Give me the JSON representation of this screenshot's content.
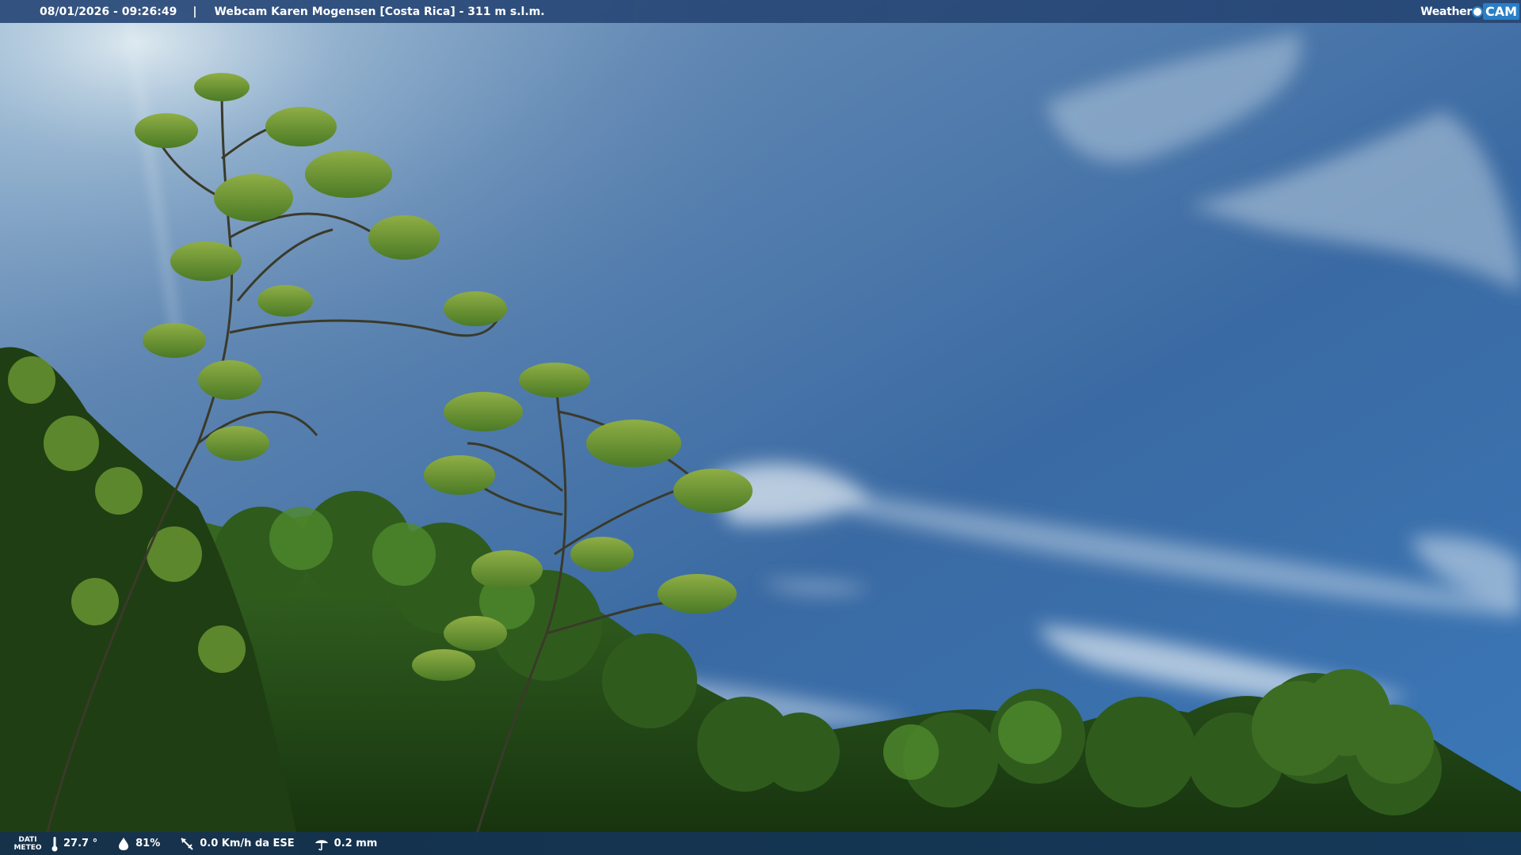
{
  "header": {
    "datetime": "08/01/2026 - 09:26:49",
    "separator": "|",
    "title": "Webcam Karen Mogensen [Costa Rica] - 311 m s.l.m."
  },
  "logo": {
    "word1": "Weather",
    "word2": "CAM"
  },
  "footer": {
    "dati_line1": "DATI",
    "dati_line2": "METEO",
    "temperature": "27.7 °",
    "humidity": "81%",
    "wind": "0.0 Km/h da ESE",
    "rain": "0.2 mm"
  },
  "icons": {
    "temperature": "thermometer-icon",
    "humidity": "humidity-drop-icon",
    "wind": "wind-vane-icon",
    "rain": "rain-gauge-icon"
  },
  "colors": {
    "sky_top": "#6f8fb0",
    "sky_mid": "#2e5f9a",
    "foliage": "#3d6a24",
    "bar": "#284878"
  }
}
